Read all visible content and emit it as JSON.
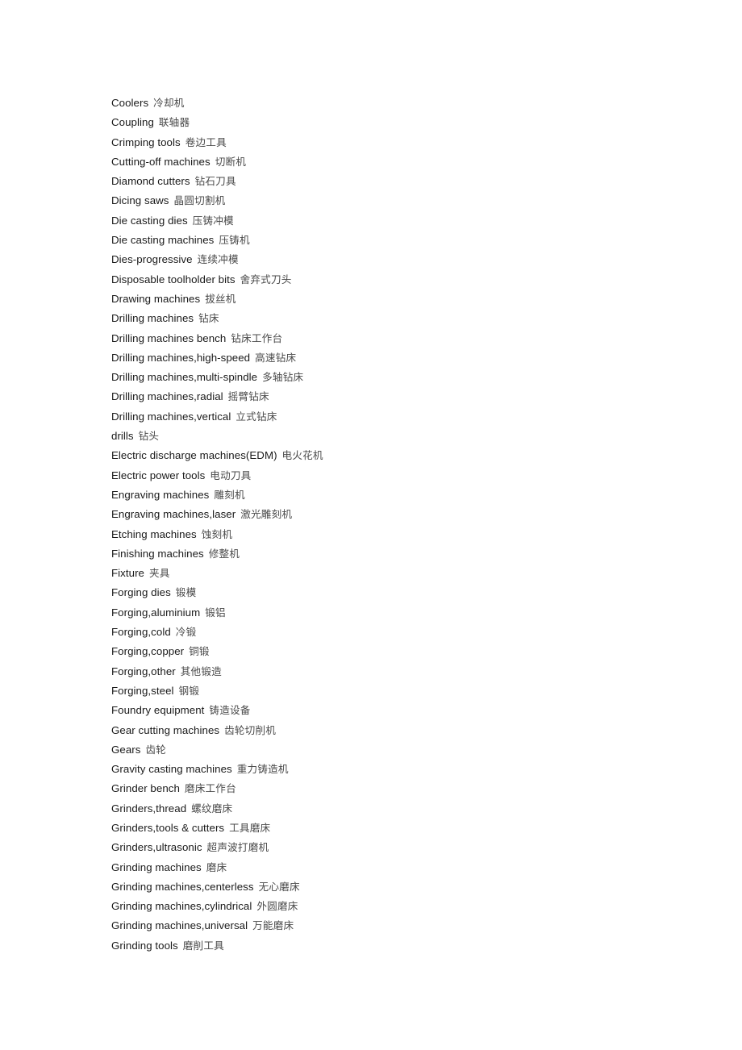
{
  "document": {
    "type": "glossary-term-list",
    "language_pair": "English-Chinese",
    "background_color": "#ffffff",
    "text_color_english": "#1a1a1a",
    "text_color_chinese": "#4a4a4a",
    "entry_count": 44
  },
  "entries": [
    {
      "en": "Coolers",
      "zh": "冷却机"
    },
    {
      "en": "Coupling",
      "zh": "联轴器"
    },
    {
      "en": "Crimping tools",
      "zh": "卷边工具"
    },
    {
      "en": "Cutting-off machines",
      "zh": "切断机"
    },
    {
      "en": "Diamond cutters",
      "zh": "钻石刀具"
    },
    {
      "en": "Dicing saws",
      "zh": "晶圆切割机"
    },
    {
      "en": "Die casting dies",
      "zh": "压铸冲模"
    },
    {
      "en": "Die casting machines",
      "zh": "压铸机"
    },
    {
      "en": "Dies-progressive",
      "zh": "连续冲模"
    },
    {
      "en": "Disposable toolholder bits",
      "zh": "舍弃式刀头"
    },
    {
      "en": "Drawing machines",
      "zh": "拔丝机"
    },
    {
      "en": "Drilling machines",
      "zh": "钻床"
    },
    {
      "en": "Drilling machines bench",
      "zh": "钻床工作台"
    },
    {
      "en": "Drilling machines,high-speed",
      "zh": "高速钻床"
    },
    {
      "en": "Drilling machines,multi-spindle",
      "zh": "多轴钻床"
    },
    {
      "en": "Drilling machines,radial",
      "zh": "摇臂钻床"
    },
    {
      "en": "Drilling machines,vertical",
      "zh": "立式钻床"
    },
    {
      "en": "drills",
      "zh": "钻头"
    },
    {
      "en": "Electric discharge machines(EDM)",
      "zh": "电火花机"
    },
    {
      "en": "Electric power tools",
      "zh": "电动刀具"
    },
    {
      "en": "Engraving machines",
      "zh": "雕刻机"
    },
    {
      "en": "Engraving machines,laser",
      "zh": "激光雕刻机"
    },
    {
      "en": "Etching machines",
      "zh": "蚀刻机"
    },
    {
      "en": "Finishing machines",
      "zh": "修整机"
    },
    {
      "en": "Fixture",
      "zh": "夹具"
    },
    {
      "en": "Forging dies",
      "zh": "锻模"
    },
    {
      "en": "Forging,aluminium",
      "zh": "锻铝"
    },
    {
      "en": "Forging,cold",
      "zh": "冷锻"
    },
    {
      "en": "Forging,copper",
      "zh": "铜锻"
    },
    {
      "en": "Forging,other",
      "zh": "其他锻造"
    },
    {
      "en": "Forging,steel",
      "zh": "钢锻"
    },
    {
      "en": "Foundry equipment",
      "zh": "铸造设备"
    },
    {
      "en": "Gear cutting machines",
      "zh": "齿轮切削机"
    },
    {
      "en": "Gears",
      "zh": "齿轮"
    },
    {
      "en": "Gravity casting machines",
      "zh": "重力铸造机"
    },
    {
      "en": "Grinder bench",
      "zh": "磨床工作台"
    },
    {
      "en": "Grinders,thread",
      "zh": "螺纹磨床"
    },
    {
      "en": "Grinders,tools & cutters",
      "zh": "工具磨床"
    },
    {
      "en": "Grinders,ultrasonic",
      "zh": "超声波打磨机"
    },
    {
      "en": "Grinding machines",
      "zh": "磨床"
    },
    {
      "en": "Grinding machines,centerless",
      "zh": "无心磨床"
    },
    {
      "en": "Grinding machines,cylindrical",
      "zh": "外圆磨床"
    },
    {
      "en": "Grinding machines,universal",
      "zh": "万能磨床"
    },
    {
      "en": "Grinding tools",
      "zh": "磨削工具"
    }
  ]
}
